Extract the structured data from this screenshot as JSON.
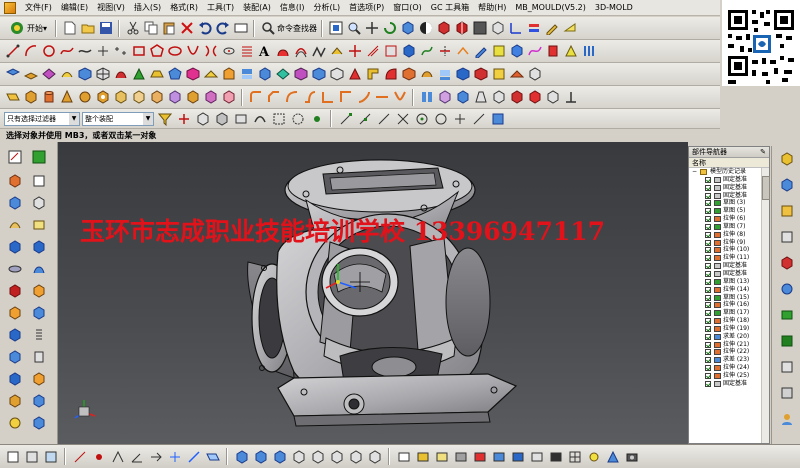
{
  "menubar": {
    "items": [
      "文件(F)",
      "编辑(E)",
      "视图(V)",
      "插入(S)",
      "格式(R)",
      "工具(T)",
      "装配(A)",
      "信息(I)",
      "分析(L)",
      "首选项(P)",
      "窗口(O)",
      "GC 工具箱",
      "帮助(H)",
      "MB_MOULD(V5.2)",
      "3D-MOLD"
    ]
  },
  "toolbar": {
    "start_label": "开始▾",
    "command_finder_label": "命令查找器"
  },
  "selection": {
    "filter_value": "只有选择过滤器",
    "scope_value": "整个装配"
  },
  "cue_line": "选择对象并使用 MB3，或者双击某一对象",
  "watermark": "玉环市志成职业技能培训学校  13396947117",
  "navigator": {
    "title": "部件导航器",
    "column_name": "名称",
    "root": "模型历史记录",
    "rows": [
      {
        "label": "固定基准"
      },
      {
        "label": "固定基准"
      },
      {
        "label": "固定基准"
      },
      {
        "label": "草图 (3)"
      },
      {
        "label": "草图 (5)"
      },
      {
        "label": "拉伸 (6)"
      },
      {
        "label": "草图 (7)"
      },
      {
        "label": "拉伸 (8)"
      },
      {
        "label": "拉伸 (9)"
      },
      {
        "label": "拉伸 (10)"
      },
      {
        "label": "拉伸 (11)"
      },
      {
        "label": "固定基准"
      },
      {
        "label": "固定基准"
      },
      {
        "label": "草图 (13)"
      },
      {
        "label": "拉伸 (14)"
      },
      {
        "label": "草图 (15)"
      },
      {
        "label": "拉伸 (16)"
      },
      {
        "label": "草图 (17)"
      },
      {
        "label": "拉伸 (18)"
      },
      {
        "label": "拉伸 (19)"
      },
      {
        "label": "求差 (20)"
      },
      {
        "label": "拉伸 (21)"
      },
      {
        "label": "拉伸 (22)"
      },
      {
        "label": "求差 (23)"
      },
      {
        "label": "拉伸 (24)"
      },
      {
        "label": "拉伸 (25)"
      },
      {
        "label": "固定基准"
      }
    ]
  },
  "colors": {
    "viewport_top": "#383a3e",
    "viewport_bottom": "#5a5c5f",
    "watermark": "#e2121a",
    "part_body": "#b9b9bc"
  }
}
